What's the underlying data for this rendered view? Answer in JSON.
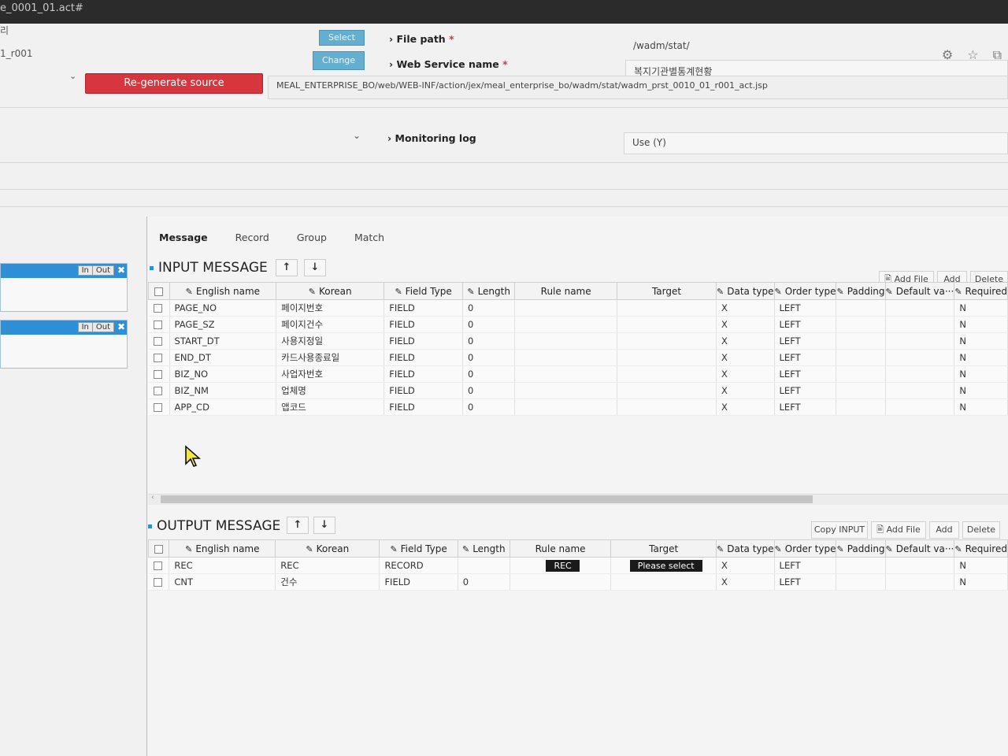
{
  "window": {
    "title": "e_0001_01.act#"
  },
  "left_labels": {
    "line1": "리",
    "line2": "1_r001"
  },
  "buttons": {
    "select": "Select",
    "change": "Change",
    "regenerate": "Re-generate source"
  },
  "fields": {
    "file_path_label": "File path",
    "file_path_value": "/wadm/stat/",
    "ws_name_label": "Web Service name",
    "ws_name_value": "복지기관별통계현황",
    "source_path": "MEAL_ENTERPRISE_BO/web/WEB-INF/action/jex/meal_enterprise_bo/wadm/stat/wadm_prst_0010_01_r001_act.jsp",
    "monitoring_label": "Monitoring log",
    "monitoring_value": "Use (Y)",
    "required_mark": "*"
  },
  "sidebar": {
    "in": "In",
    "out": "Out"
  },
  "tabs": [
    "Message",
    "Record",
    "Group",
    "Match"
  ],
  "input_section": {
    "title": "INPUT MESSAGE",
    "buttons": {
      "add_file": "Add File",
      "add": "Add",
      "delete": "Delete"
    },
    "columns": [
      "English name",
      "Korean",
      "Field Type",
      "Length",
      "Rule name",
      "Target",
      "Data type",
      "Order type",
      "Padding",
      "Default va···",
      "Required"
    ],
    "rows": [
      [
        "PAGE_NO",
        "페이지번호",
        "FIELD",
        "0",
        "",
        "",
        "X",
        "LEFT",
        "",
        "",
        "N"
      ],
      [
        "PAGE_SZ",
        "페이지건수",
        "FIELD",
        "0",
        "",
        "",
        "X",
        "LEFT",
        "",
        "",
        "N"
      ],
      [
        "START_DT",
        "사용지정일",
        "FIELD",
        "0",
        "",
        "",
        "X",
        "LEFT",
        "",
        "",
        "N"
      ],
      [
        "END_DT",
        "카드사용종료일",
        "FIELD",
        "0",
        "",
        "",
        "X",
        "LEFT",
        "",
        "",
        "N"
      ],
      [
        "BIZ_NO",
        "사업자번호",
        "FIELD",
        "0",
        "",
        "",
        "X",
        "LEFT",
        "",
        "",
        "N"
      ],
      [
        "BIZ_NM",
        "업체명",
        "FIELD",
        "0",
        "",
        "",
        "X",
        "LEFT",
        "",
        "",
        "N"
      ],
      [
        "APP_CD",
        "앱코드",
        "FIELD",
        "0",
        "",
        "",
        "X",
        "LEFT",
        "",
        "",
        "N"
      ]
    ]
  },
  "output_section": {
    "title": "OUTPUT MESSAGE",
    "buttons": {
      "copy_input": "Copy INPUT",
      "add_file": "Add File",
      "add": "Add",
      "delete": "Delete"
    },
    "columns": [
      "English name",
      "Korean",
      "Field Type",
      "Length",
      "Rule name",
      "Target",
      "Data type",
      "Order type",
      "Padding",
      "Default va···",
      "Required"
    ],
    "rows": [
      [
        "REC",
        "REC",
        "RECORD",
        "",
        "REC",
        "Please select",
        "X",
        "LEFT",
        "",
        "",
        "N"
      ],
      [
        "CNT",
        "건수",
        "FIELD",
        "0",
        "",
        "",
        "X",
        "LEFT",
        "",
        "",
        "N"
      ]
    ]
  },
  "colors": {
    "accent_blue": "#2f8fd6",
    "button_blue": "#64aecf",
    "regen_red": "#d8363e"
  }
}
